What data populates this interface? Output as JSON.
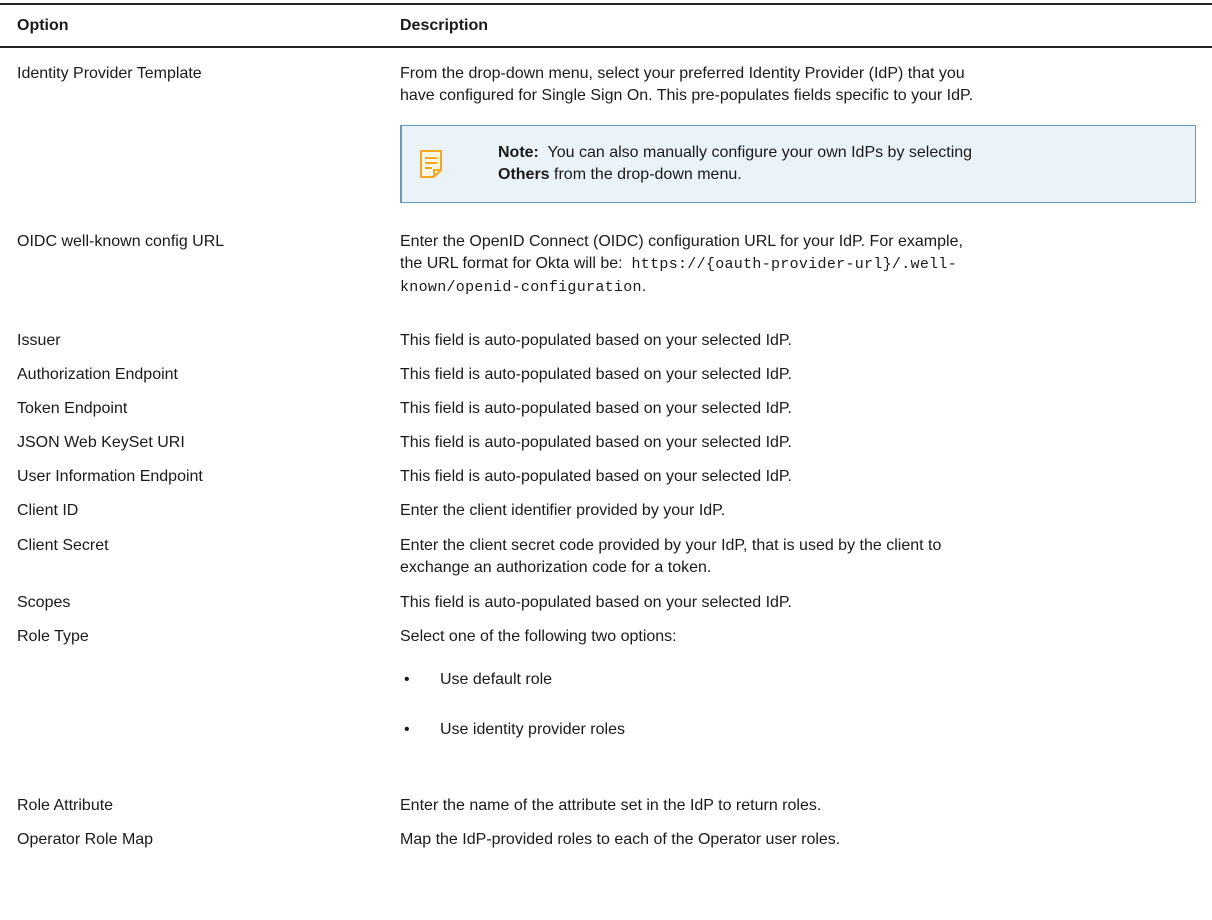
{
  "header": {
    "option": "Option",
    "description": "Description"
  },
  "note": {
    "label": "Note:",
    "text_before": "You can also manually configure your own IdPs by selecting",
    "bold_word": "Others",
    "text_after": "from the drop-down menu."
  },
  "rows": [
    {
      "option": "Identity Provider Template",
      "desc1": "From the drop-down menu, select your preferred Identity Provider (IdP) that you",
      "desc2": "have configured for Single Sign On. This pre-populates fields specific to your IdP."
    },
    {
      "option": "OIDC well-known config URL",
      "desc1": "Enter the OpenID Connect (OIDC) configuration URL for your IdP. For example,",
      "desc2_prefix": "the URL format for Okta will be:",
      "url_part1": "https://{oauth-provider-url}/.well-",
      "url_part2": "known/openid-configuration",
      "url_suffix": "."
    },
    {
      "option": "Issuer",
      "desc1": "This field is auto-populated based on your selected IdP."
    },
    {
      "option": "Authorization Endpoint",
      "desc1": "This field is auto-populated based on your selected IdP."
    },
    {
      "option": "Token Endpoint",
      "desc1": "This field is auto-populated based on your selected IdP."
    },
    {
      "option": "JSON Web KeySet URI",
      "desc1": "This field is auto-populated based on your selected IdP."
    },
    {
      "option": "User Information Endpoint",
      "desc1": "This field is auto-populated based on your selected IdP."
    },
    {
      "option": "Client ID",
      "desc1": "Enter the client identifier provided by your IdP."
    },
    {
      "option": "Client Secret",
      "desc1": "Enter the client secret code provided by your IdP, that is used by the client to",
      "desc2": "exchange an authorization code for a token."
    },
    {
      "option": "Scopes",
      "desc1": "This field is auto-populated based on your selected IdP."
    },
    {
      "option": "Role Type",
      "desc1": "Select one of the following two options:",
      "bullets": [
        "Use default role",
        "Use identity provider roles"
      ]
    },
    {
      "option": "Role Attribute",
      "desc1": "Enter the name of the attribute set in the IdP to return roles."
    },
    {
      "option": "Operator Role Map",
      "desc1": "Map the IdP-provided roles to each of the Operator user roles."
    }
  ],
  "icons": {
    "note": "note-icon",
    "note_color": "#f5a623"
  }
}
